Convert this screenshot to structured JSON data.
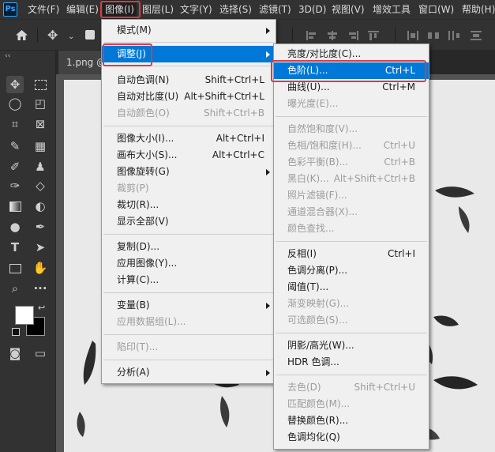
{
  "menubar": {
    "logo": "Ps",
    "items": [
      "文件(F)",
      "编辑(E)",
      "图像(I)",
      "图层(L)",
      "文字(Y)",
      "选择(S)",
      "滤镜(T)",
      "3D(D)",
      "视图(V)",
      "增效工具",
      "窗口(W)",
      "帮助(H)"
    ],
    "active_item": "图像(I)"
  },
  "document": {
    "tab_label": "1.png @"
  },
  "image_menu": {
    "items": [
      {
        "label": "模式(M)",
        "submenu": true
      },
      {
        "label": "调整(J)",
        "submenu": true,
        "highlighted": true
      },
      {
        "label": "自动色调(N)",
        "shortcut": "Shift+Ctrl+L"
      },
      {
        "label": "自动对比度(U)",
        "shortcut": "Alt+Shift+Ctrl+L"
      },
      {
        "label": "自动颜色(O)",
        "shortcut": "Shift+Ctrl+B",
        "disabled": true
      },
      {
        "label": "图像大小(I)...",
        "shortcut": "Alt+Ctrl+I"
      },
      {
        "label": "画布大小(S)...",
        "shortcut": "Alt+Ctrl+C"
      },
      {
        "label": "图像旋转(G)",
        "submenu": true
      },
      {
        "label": "裁剪(P)",
        "disabled": true
      },
      {
        "label": "裁切(R)..."
      },
      {
        "label": "显示全部(V)"
      },
      {
        "label": "复制(D)..."
      },
      {
        "label": "应用图像(Y)..."
      },
      {
        "label": "计算(C)..."
      },
      {
        "label": "变量(B)",
        "submenu": true
      },
      {
        "label": "应用数据组(L)...",
        "disabled": true
      },
      {
        "label": "陷印(T)...",
        "disabled": true
      },
      {
        "label": "分析(A)",
        "submenu": true
      }
    ]
  },
  "adjust_menu": {
    "items": [
      {
        "label": "亮度/对比度(C)..."
      },
      {
        "label": "色阶(L)...",
        "shortcut": "Ctrl+L",
        "highlighted": true
      },
      {
        "label": "曲线(U)...",
        "shortcut": "Ctrl+M"
      },
      {
        "label": "曝光度(E)...",
        "disabled": true
      },
      {
        "label": "自然饱和度(V)...",
        "disabled": true
      },
      {
        "label": "色相/饱和度(H)...",
        "shortcut": "Ctrl+U",
        "disabled": true
      },
      {
        "label": "色彩平衡(B)...",
        "shortcut": "Ctrl+B",
        "disabled": true
      },
      {
        "label": "黑白(K)...",
        "shortcut": "Alt+Shift+Ctrl+B",
        "disabled": true
      },
      {
        "label": "照片滤镜(F)...",
        "disabled": true
      },
      {
        "label": "通道混合器(X)...",
        "disabled": true
      },
      {
        "label": "颜色查找...",
        "disabled": true
      },
      {
        "label": "反相(I)",
        "shortcut": "Ctrl+I"
      },
      {
        "label": "色调分离(P)..."
      },
      {
        "label": "阈值(T)..."
      },
      {
        "label": "渐变映射(G)...",
        "disabled": true
      },
      {
        "label": "可选颜色(S)...",
        "disabled": true
      },
      {
        "label": "阴影/高光(W)..."
      },
      {
        "label": "HDR 色调..."
      },
      {
        "label": "去色(D)",
        "shortcut": "Shift+Ctrl+U",
        "disabled": true
      },
      {
        "label": "匹配颜色(M)...",
        "disabled": true
      },
      {
        "label": "替换颜色(R)..."
      },
      {
        "label": "色调均化(Q)"
      }
    ]
  },
  "colors": {
    "highlight": "#0078d7",
    "annotation_frame": "#e0393e",
    "foreground_swatch": "#ffffff",
    "background_swatch": "#000000"
  }
}
